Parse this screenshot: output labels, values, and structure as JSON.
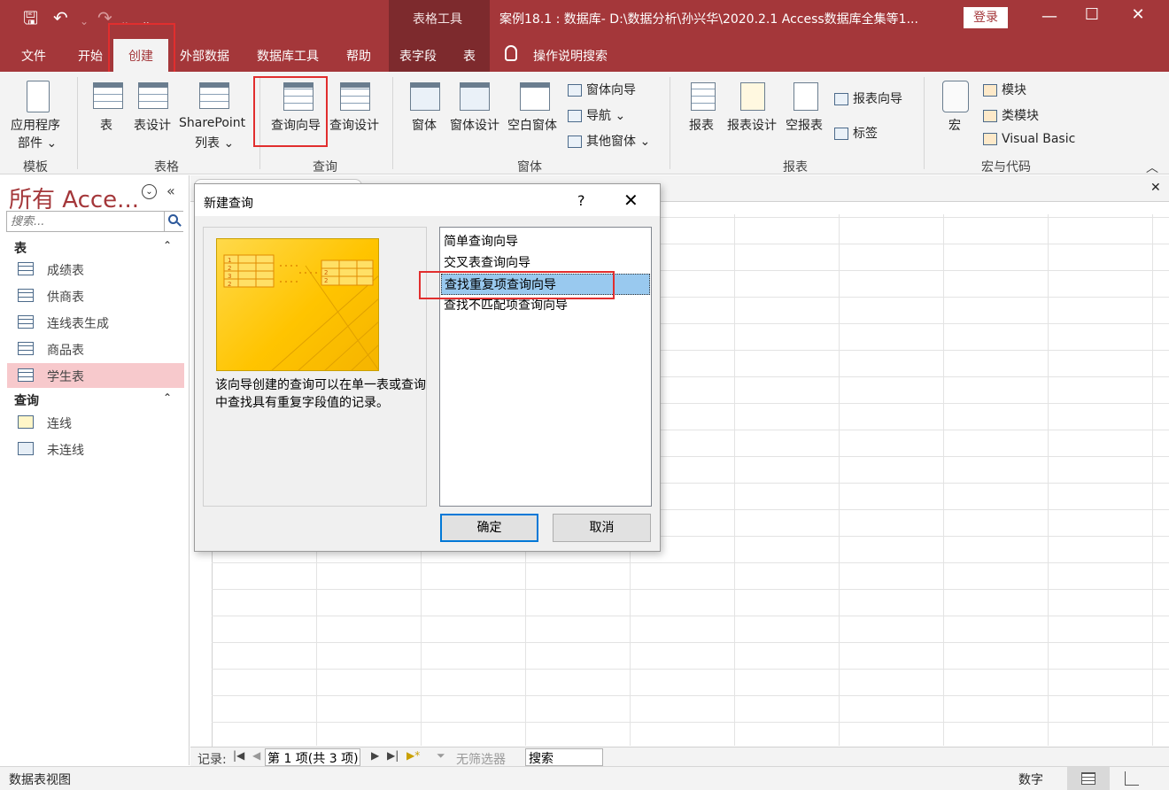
{
  "window": {
    "context_tool": "表格工具",
    "doc_title": "案例18.1 : 数据库- D:\\数据分析\\孙兴华\\2020.2.1 Access数据库全集等1...",
    "login": "登录",
    "min": "—",
    "max": "☐",
    "close": "✕"
  },
  "qat": {
    "save": "🖫",
    "undo": "↶",
    "redo": "↷",
    "customize": "⌄"
  },
  "tabs": [
    {
      "label": "文件"
    },
    {
      "label": "开始"
    },
    {
      "label": "创建"
    },
    {
      "label": "外部数据"
    },
    {
      "label": "数据库工具"
    },
    {
      "label": "帮助"
    },
    {
      "label": "表字段"
    },
    {
      "label": "表"
    },
    {
      "label": "操作说明搜索"
    }
  ],
  "ribbon": {
    "groups": {
      "template": "模板",
      "tables": "表格",
      "queries": "查询",
      "forms": "窗体",
      "reports": "报表",
      "macros": "宏与代码"
    },
    "app_parts": "应用程序",
    "app_parts2": "部件 ⌄",
    "table": "表",
    "table_design": "表设计",
    "sharepoint": "SharePoint",
    "sharepoint2": "列表 ⌄",
    "query_wizard": "查询向导",
    "query_design": "查询设计",
    "form": "窗体",
    "form_design": "窗体设计",
    "blank_form": "空白窗体",
    "form_wizard": "窗体向导",
    "navigation": "导航 ⌄",
    "more_forms": "其他窗体 ⌄",
    "report": "报表",
    "report_design": "报表设计",
    "blank_report": "空报表",
    "report_wizard": "报表向导",
    "labels": "标签",
    "macro": "宏",
    "module": "模块",
    "class_module": "类模块",
    "visual_basic": "Visual Basic",
    "collapse": "︿"
  },
  "nav": {
    "title": "所有 Acce...",
    "search_placeholder": "搜索...",
    "tables_header": "表",
    "tables": [
      "成绩表",
      "供商表",
      "连线表生成",
      "商品表",
      "学生表"
    ],
    "queries_header": "查询",
    "queries": [
      "连线",
      "未连线"
    ],
    "collapse": "«",
    "chevron": "⌄"
  },
  "dialog": {
    "title": "新建查询",
    "help": "?",
    "close": "✕",
    "description": "该向导创建的查询可以在单一表或查询中查找具有重复字段值的记录。",
    "options": [
      "简单查询向导",
      "交叉表查询向导",
      "查找重复项查询向导",
      "查找不匹配项查询向导"
    ],
    "selected_index": 2,
    "ok": "确定",
    "cancel": "取消"
  },
  "record_bar": {
    "label": "记录:",
    "position": "第 1 项(共 3 项)",
    "filter": "无筛选器",
    "search": "搜索"
  },
  "status": {
    "left": "数据表视图",
    "num": "数字"
  },
  "content": {
    "close": "✕"
  }
}
